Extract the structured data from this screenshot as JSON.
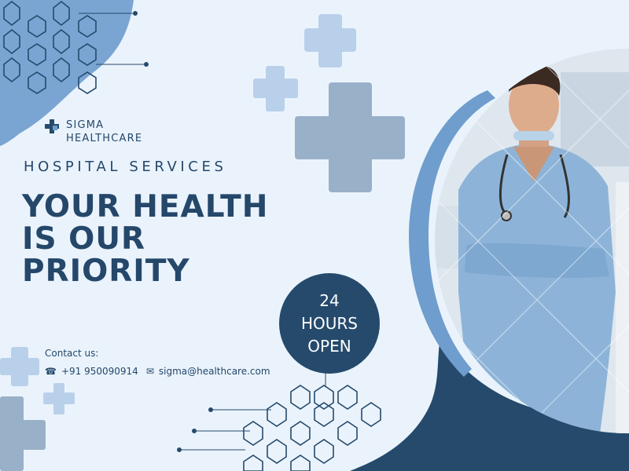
{
  "brand": {
    "name_line1": "SIGMA",
    "name_line2": "HEALTHCARE"
  },
  "headline": {
    "kicker": "HOSPITAL SERVICES",
    "line1": "YOUR HEALTH",
    "line2": "IS OUR",
    "line3": "PRIORITY"
  },
  "badge": {
    "line1": "24",
    "line2": "HOURS",
    "line3": "OPEN"
  },
  "contact": {
    "label": "Contact us:",
    "phone": "+91 950090914",
    "email": "sigma@healthcare.com"
  },
  "colors": {
    "background": "#eaf3fc",
    "navy": "#254a6c",
    "blue": "#6f9dcd",
    "light_blue": "#b9d0ea"
  },
  "icons": [
    "medical-cross-icon",
    "phone-icon",
    "mail-icon"
  ]
}
